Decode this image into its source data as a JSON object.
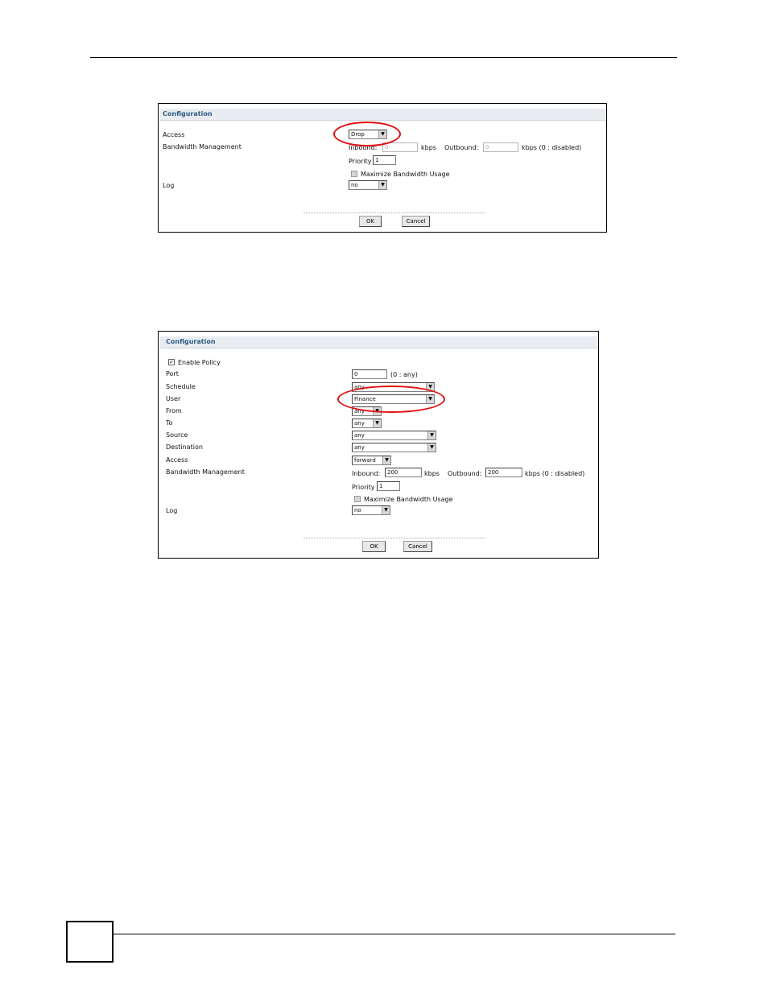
{
  "figure1": {
    "title": "Configuration",
    "labels": {
      "access": "Access",
      "bandwidth": "Bandwidth Management",
      "log": "Log"
    },
    "access_value": "Drop",
    "inbound_label": "Inbound:",
    "inbound_value": "0",
    "kbps1": "kbps",
    "outbound_label": "Outbound:",
    "outbound_value": "0",
    "kbps_disabled": "kbps (0 : disabled)",
    "priority_label": "Priority",
    "priority_value": "1",
    "maximize_label": "Maximize Bandwidth Usage",
    "log_value": "no",
    "ok_label": "OK",
    "cancel_label": "Cancel"
  },
  "figure2": {
    "title": "Configuration",
    "enable_policy_label": "Enable Policy",
    "labels": {
      "port": "Port",
      "schedule": "Schedule",
      "user": "User",
      "from": "From",
      "to": "To",
      "source": "Source",
      "destination": "Destination",
      "access": "Access",
      "bandwidth": "Bandwidth Management",
      "log": "Log"
    },
    "port_value": "0",
    "port_hint": "(0 : any)",
    "schedule_value": "any",
    "user_value": "Finance",
    "from_value": "any",
    "to_value": "any",
    "source_value": "any",
    "destination_value": "any",
    "access_value": "forward",
    "inbound_label": "Inbound:",
    "inbound_value": "200",
    "kbps1": "kbps",
    "outbound_label": "Outbound:",
    "outbound_value": "200",
    "kbps_disabled": "kbps (0 : disabled)",
    "priority_label": "Priority",
    "priority_value": "1",
    "maximize_label": "Maximize Bandwidth Usage",
    "log_value": "no",
    "ok_label": "OK",
    "cancel_label": "Cancel"
  },
  "colors": {
    "highlight": "#e01010",
    "title_text": "#2f5c86",
    "title_bar": "#e9ecf0"
  }
}
